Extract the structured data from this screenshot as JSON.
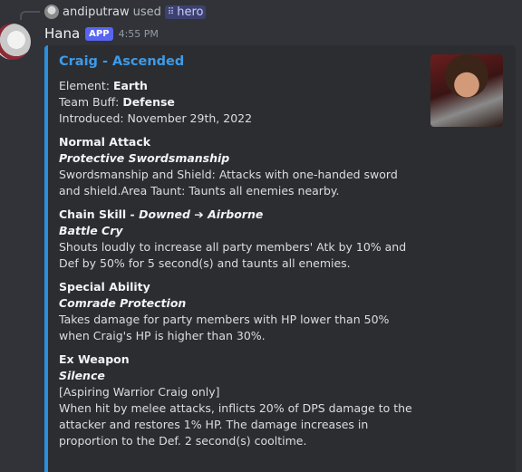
{
  "reply": {
    "user": "andiputraw",
    "verb": "used",
    "command": "hero"
  },
  "message": {
    "author": "Hana",
    "badge": "APP",
    "time": "4:55 PM"
  },
  "embed": {
    "accent_color": "#2b8fdc",
    "title": "Craig - Ascended",
    "info": {
      "element_label": "Element: ",
      "element_value": "Earth",
      "buff_label": "Team Buff: ",
      "buff_value": "Defense",
      "introduced": "Introduced: November 29th, 2022"
    },
    "fields": [
      {
        "name": "Normal Attack",
        "skill": "Protective Swordsmanship",
        "body": "Swordsmanship and Shield: Attacks with one-handed sword and shield.Area Taunt: Taunts all enemies nearby."
      },
      {
        "name": "Chain Skill ",
        "suffix": " - Downed ➔ Airborne",
        "skill": "Battle Cry",
        "body": "Shouts loudly to increase all party members' Atk by 10% and Def by 50% for 5 second(s) and taunts all enemies."
      },
      {
        "name": "Special Ability",
        "skill": "Comrade Protection",
        "body": "Takes damage for party members with HP lower than 50% when Craig's HP is higher than 30%."
      },
      {
        "name": "Ex Weapon",
        "skill": "Silence",
        "note": "[Aspiring Warrior Craig only]",
        "body": "When hit by melee attacks, inflicts 20% of DPS damage to the attacker and restores 1% HP. The damage increases in proportion to the Def. 2 second(s) cooltime."
      }
    ]
  }
}
